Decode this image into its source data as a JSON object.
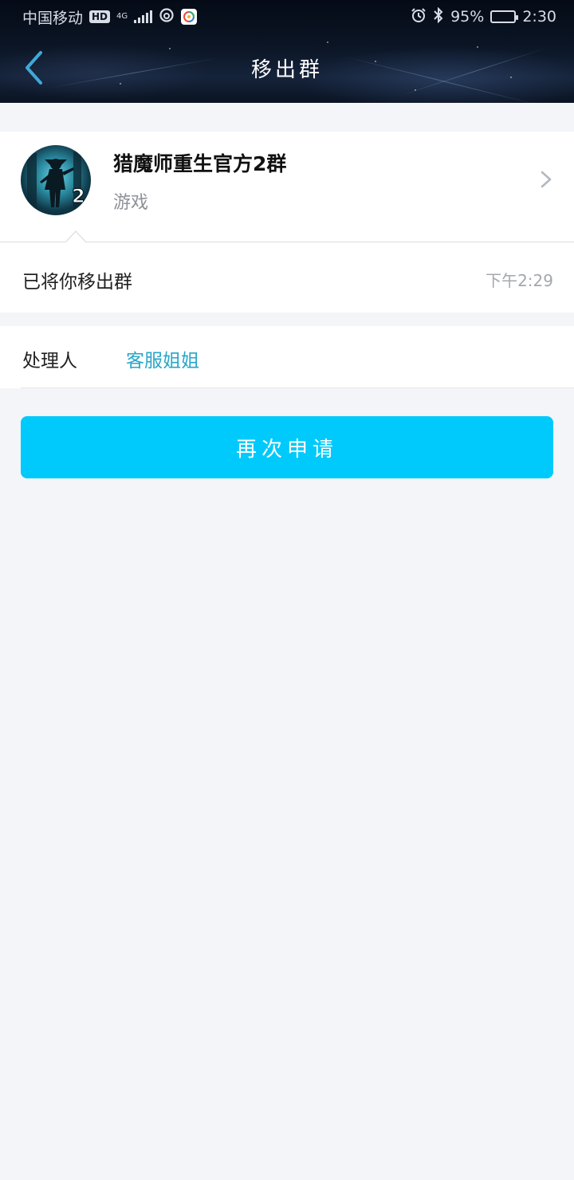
{
  "status_bar": {
    "carrier": "中国移动",
    "hd_badge": "HD",
    "network": "4G",
    "network_sub": "2G",
    "battery": "95%",
    "battery_level": 0.95,
    "time": "2:30",
    "icons": [
      "hd-icon",
      "signal-icon",
      "netease-music-icon",
      "app-icon",
      "alarm-icon",
      "bluetooth-icon",
      "battery-icon"
    ]
  },
  "header": {
    "title": "移出群",
    "back_icon": "chevron-left-icon"
  },
  "group": {
    "name": "猎魔师重生官方2群",
    "category": "游戏",
    "avatar_badge": "2"
  },
  "message": {
    "text": "已将你移出群",
    "time": "下午2:29"
  },
  "handler": {
    "label": "处理人",
    "name": "客服姐姐"
  },
  "actions": {
    "apply_again_label": "再次申请"
  },
  "colors": {
    "accent": "#00cafc",
    "link": "#26a6c9",
    "background": "#f3f5f8"
  }
}
